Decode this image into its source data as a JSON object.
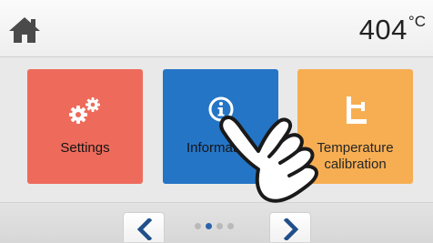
{
  "header": {
    "home_icon": "home-icon",
    "temperature_value": "404",
    "temperature_unit": "°C"
  },
  "tiles": [
    {
      "label": "Settings",
      "icon": "gears-icon",
      "color": "#ee6b5b"
    },
    {
      "label": "Information",
      "icon": "info-icon",
      "color": "#2575c6"
    },
    {
      "label": "Temperature calibration",
      "icon": "calibration-icon",
      "color": "#f7ae52"
    }
  ],
  "pagination": {
    "prev_icon": "chevron-left-icon",
    "next_icon": "chevron-right-icon",
    "page_count": 4,
    "current_page": 2
  },
  "overlay": {
    "icon": "pointing-hand-icon"
  },
  "colors": {
    "accent": "#2a64a8",
    "nav_arrow": "#1f4f8a"
  }
}
